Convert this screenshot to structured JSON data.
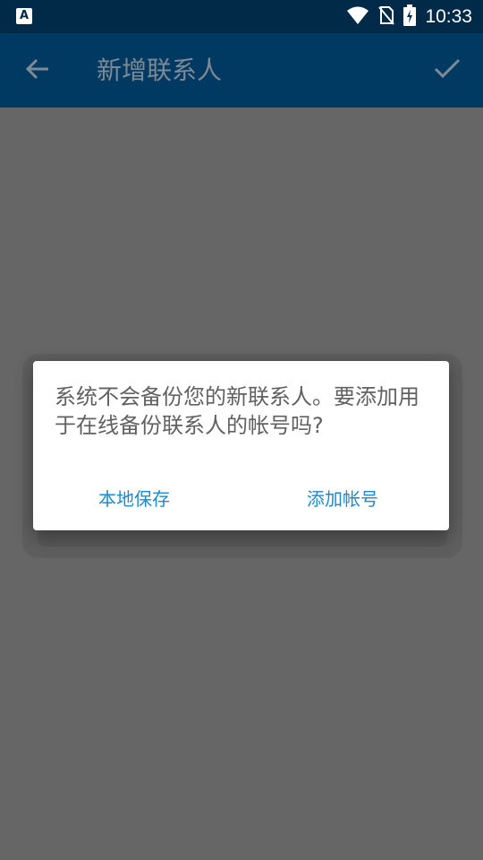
{
  "status_bar": {
    "time": "10:33",
    "left_icon": "A",
    "icons": [
      "wifi-icon",
      "no-sim-icon",
      "battery-charging-icon"
    ]
  },
  "app_bar": {
    "title": "新增联系人",
    "back_icon": "arrow-back-icon",
    "confirm_icon": "check-icon"
  },
  "dialog": {
    "message": "系统不会备份您的新联系人。要添加用于在线备份联系人的帐号吗?",
    "local_save_label": "本地保存",
    "add_account_label": "添加帐号"
  },
  "colors": {
    "status_bar": "#002a47",
    "app_bar": "#003a62",
    "accent": "#1c8ad2",
    "scrim": "#666666"
  }
}
